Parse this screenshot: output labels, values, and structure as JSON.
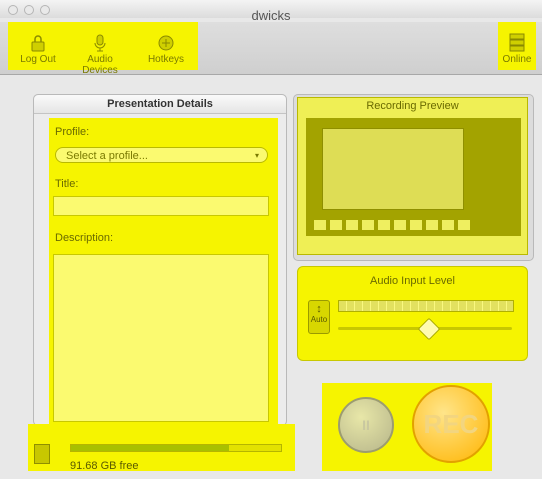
{
  "window": {
    "title": "dwicks"
  },
  "toolbar": {
    "logout_label": "Log Out",
    "audio_devices_label": "Audio Devices",
    "hotkeys_label": "Hotkeys",
    "online_label": "Online"
  },
  "presentation": {
    "header": "Presentation Details",
    "profile_label": "Profile:",
    "profile_select": "Select a profile...",
    "title_label": "Title:",
    "title_value": "",
    "description_label": "Description:",
    "description_value": ""
  },
  "preview": {
    "header": "Recording Preview"
  },
  "audio": {
    "header": "Audio Input Level",
    "auto_label": "Auto",
    "level_fraction": 0.0,
    "slider_fraction": 0.52
  },
  "controls": {
    "pause_label": "II",
    "rec_label": "REC"
  },
  "disk": {
    "free_label": "91.68 GB free",
    "used_fraction": 0.75
  },
  "colors": {
    "highlight": "#f6f400",
    "rec": "#ffb400"
  }
}
